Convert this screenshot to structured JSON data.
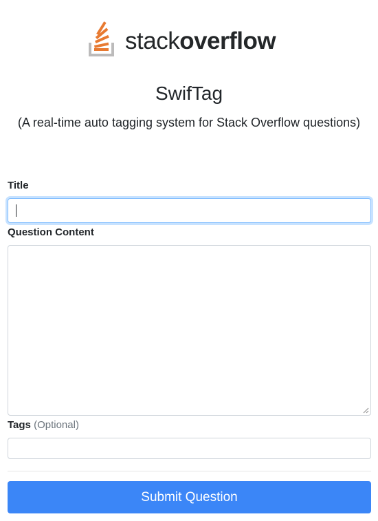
{
  "brand": {
    "logo_text_light": "stack",
    "logo_text_bold": "overflow",
    "colors": {
      "orange": "#e87a31",
      "gray": "#bcbbbb",
      "text": "#242729"
    },
    "icon": "stackoverflow-logo-icon"
  },
  "header": {
    "title": "SwifTag",
    "subtitle": "(A real-time auto tagging system for Stack Overflow questions)"
  },
  "form": {
    "title_label": "Title",
    "title_value": "",
    "question_label": "Question Content",
    "question_value": "",
    "tags_label": "Tags",
    "tags_optional": "(Optional)",
    "tags_value": "",
    "submit_label": "Submit Question"
  },
  "theme": {
    "primary": "#3b86f7",
    "focus_border": "#80bdff"
  }
}
